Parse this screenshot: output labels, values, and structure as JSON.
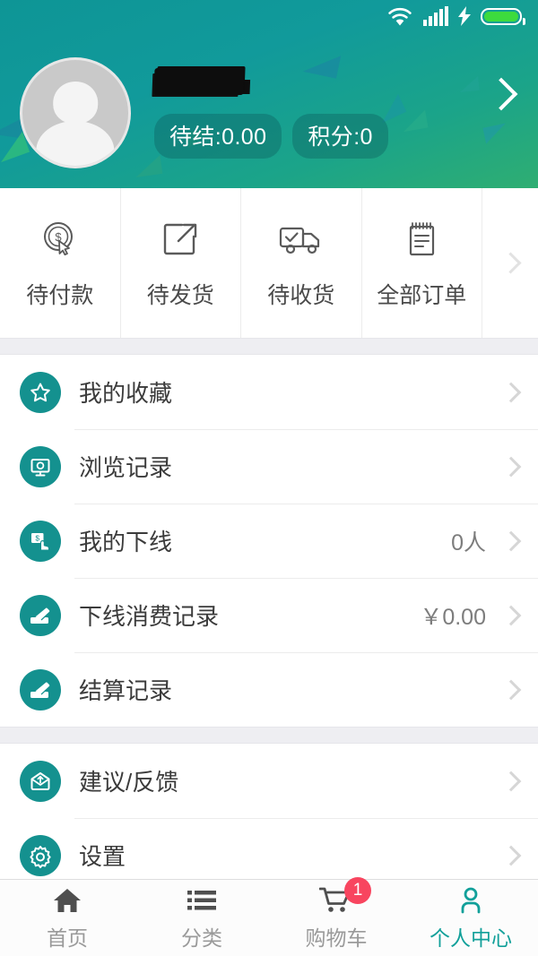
{
  "status_bar": {
    "wifi_icon": "wifi-icon",
    "signal_icon": "signal-bars-icon",
    "charging_icon": "lightning-bolt-icon",
    "battery_icon": "battery-icon",
    "battery_color": "#3ddb3d"
  },
  "header": {
    "avatar_icon": "default-avatar-icon",
    "username": "",
    "username_redacted": true,
    "pills": [
      {
        "label": "待结:0.00",
        "name": "pending-settlement-badge"
      },
      {
        "label": "积分:0",
        "name": "points-badge"
      }
    ],
    "chevron_icon": "chevron-right-icon",
    "bg_start": "#119a9b",
    "bg_end": "#2fae72"
  },
  "order_tabs": {
    "items": [
      {
        "label": "待付款",
        "icon": "coin-cursor-icon",
        "name": "order-tab-unpaid"
      },
      {
        "label": "待发货",
        "icon": "export-box-icon",
        "name": "order-tab-unshipped"
      },
      {
        "label": "待收货",
        "icon": "delivery-truck-icon",
        "name": "order-tab-unreceived"
      },
      {
        "label": "全部订单",
        "icon": "notepad-icon",
        "name": "order-tab-all"
      }
    ],
    "arrow_icon": "chevron-right-icon"
  },
  "sections": [
    {
      "name": "account-section",
      "rows": [
        {
          "label": "我的收藏",
          "value": "",
          "icon": "star-icon",
          "name": "row-my-favorites"
        },
        {
          "label": "浏览记录",
          "value": "",
          "icon": "monitor-history-icon",
          "name": "row-browse-history"
        },
        {
          "label": "我的下线",
          "value": "0人",
          "icon": "money-hand-icon",
          "name": "row-my-downline"
        },
        {
          "label": "下线消费记录",
          "value": "￥0.00",
          "icon": "card-swipe-icon",
          "name": "row-downline-spending"
        },
        {
          "label": "结算记录",
          "value": "",
          "icon": "card-swipe-icon",
          "name": "row-settlement-records"
        }
      ]
    },
    {
      "name": "support-section",
      "rows": [
        {
          "label": "建议/反馈",
          "value": "",
          "icon": "envelope-feedback-icon",
          "name": "row-feedback"
        },
        {
          "label": "设置",
          "value": "",
          "icon": "gear-icon",
          "name": "row-settings"
        }
      ]
    }
  ],
  "tabbar": {
    "items": [
      {
        "label": "首页",
        "icon": "home-icon",
        "name": "tab-home",
        "active": false,
        "badge": ""
      },
      {
        "label": "分类",
        "icon": "list-icon",
        "name": "tab-category",
        "active": false,
        "badge": ""
      },
      {
        "label": "购物车",
        "icon": "cart-icon",
        "name": "tab-cart",
        "active": false,
        "badge": "1"
      },
      {
        "label": "个人中心",
        "icon": "person-icon",
        "name": "tab-profile",
        "active": true,
        "badge": ""
      }
    ],
    "active_color": "#12a09a",
    "badge_color": "#f8455f"
  }
}
